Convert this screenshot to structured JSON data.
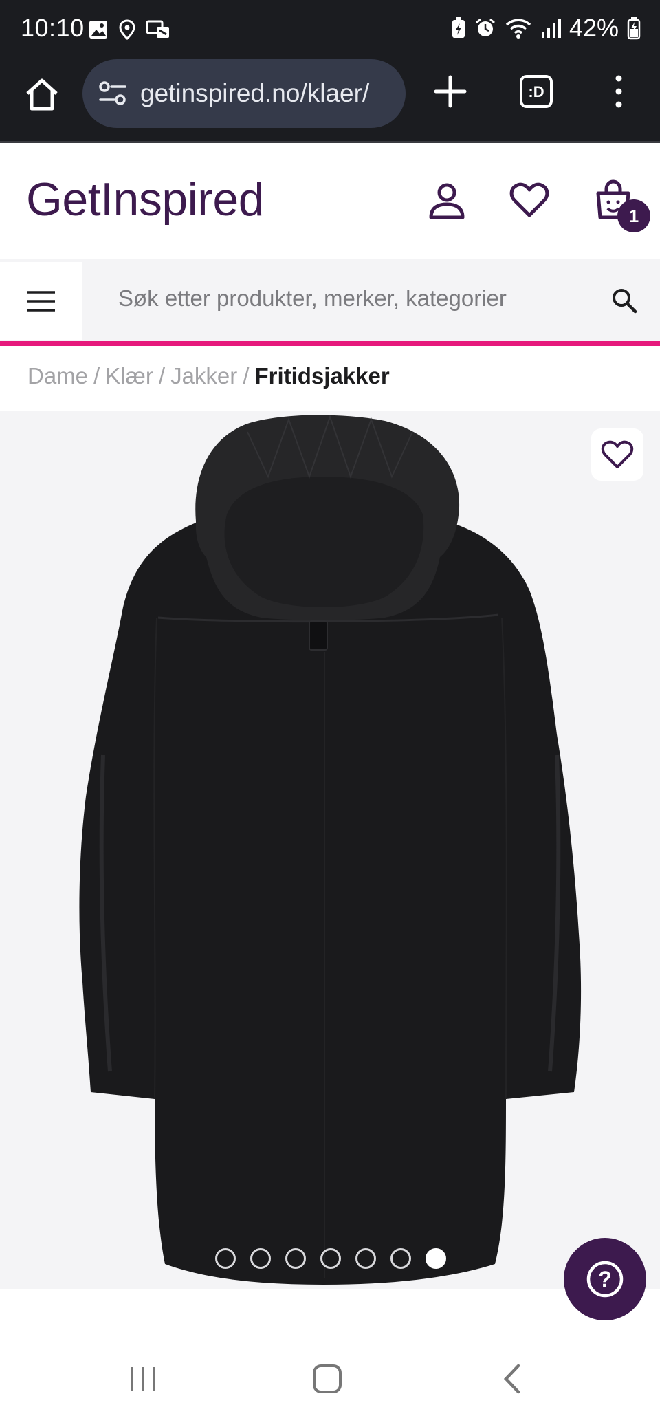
{
  "status_bar": {
    "time": "10:10",
    "battery": "42%",
    "left_icons": [
      "image-icon",
      "location-icon",
      "cast-icon"
    ],
    "right_icons": [
      "battery-saver-icon",
      "alarm-icon",
      "wifi-icon",
      "signal-icon",
      "battery-icon"
    ]
  },
  "browser": {
    "url": "getinspired.no/klaer/",
    "tabs_label": ":D"
  },
  "site": {
    "logo": "GetInspired",
    "cart_count": "1",
    "brand_color": "#3d1a4e",
    "accent_color": "#e6197c"
  },
  "search": {
    "placeholder": "Søk etter produkter, merker, kategorier"
  },
  "breadcrumb": {
    "items": [
      "Dame",
      "Klær",
      "Jakker"
    ],
    "current": "Fritidsjakker"
  },
  "gallery": {
    "image_count": 7,
    "active_index": 6
  },
  "help": {
    "label": "?"
  }
}
